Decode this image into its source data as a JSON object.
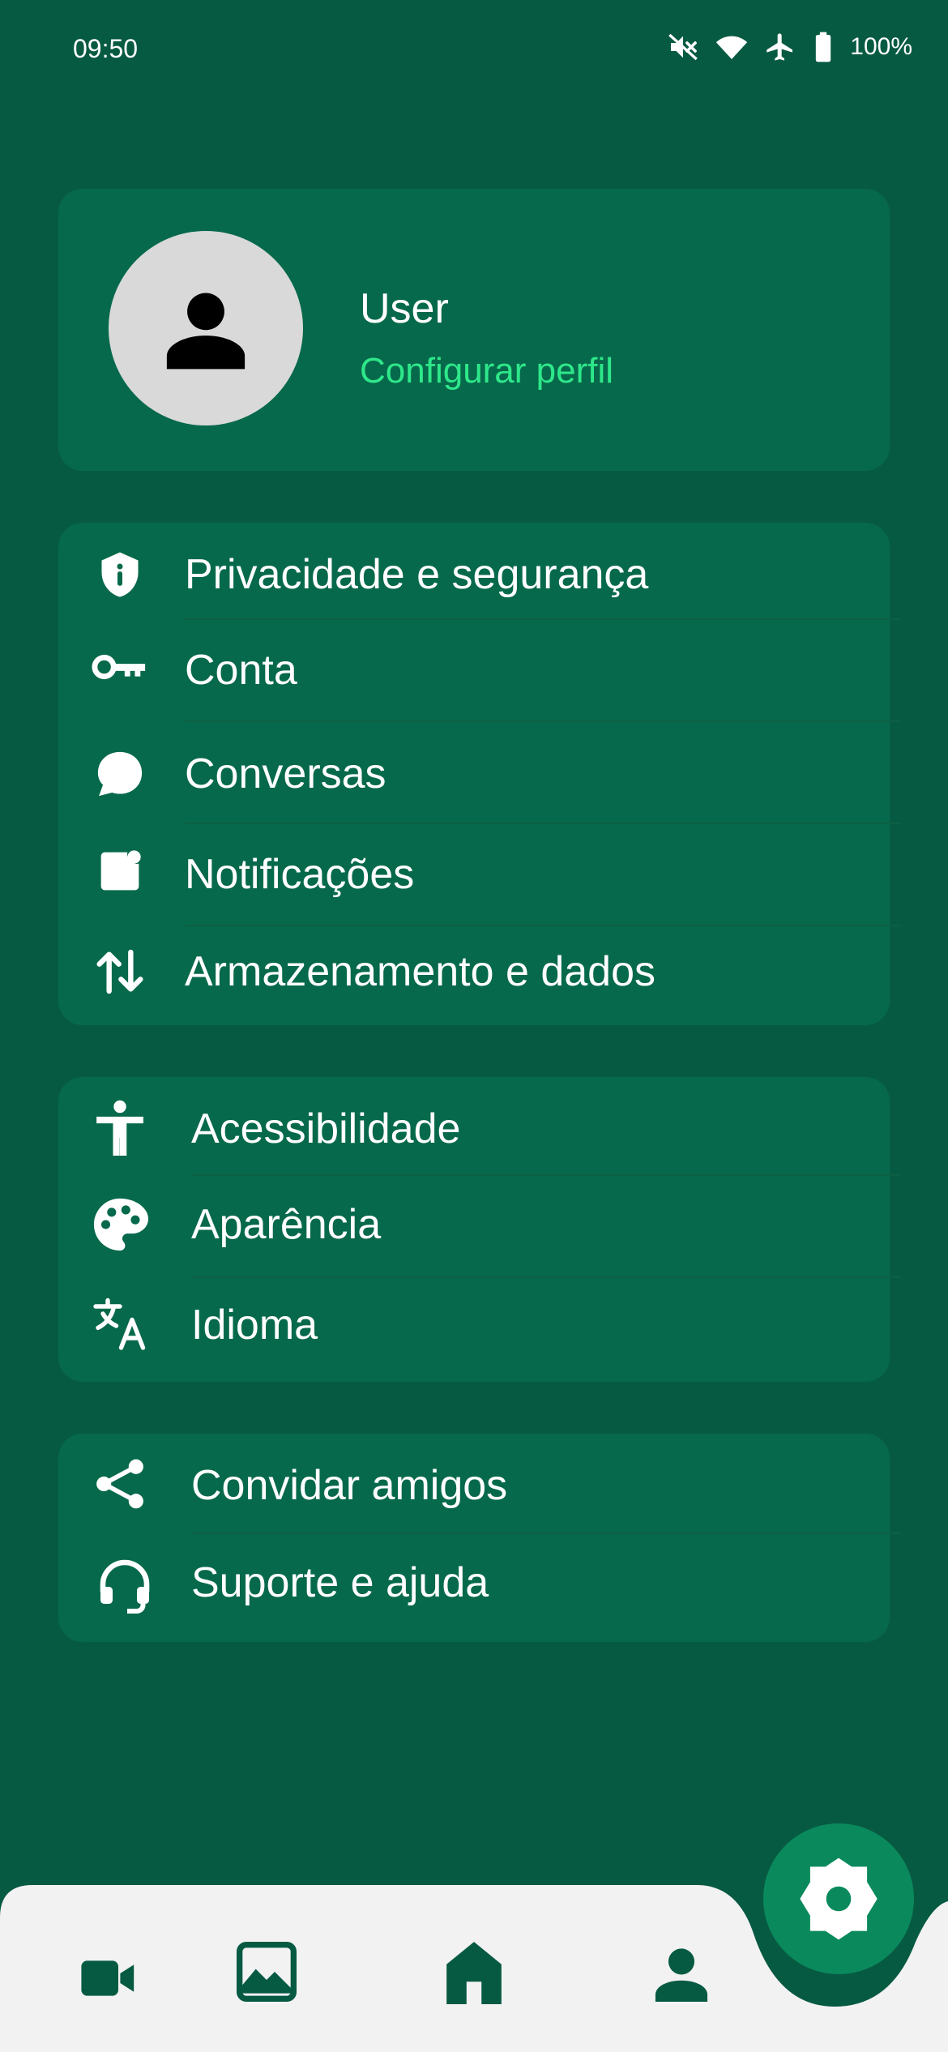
{
  "status_bar": {
    "time": "09:50",
    "battery_text": "100%",
    "icons": [
      "mute-icon",
      "wifi-icon",
      "airplane-icon",
      "battery-icon"
    ]
  },
  "profile": {
    "name": "User",
    "link": "Configurar perfil"
  },
  "settings": {
    "group1": [
      {
        "label": "Privacidade e segurança",
        "icon": "shield-icon"
      },
      {
        "label": "Conta",
        "icon": "key-icon"
      },
      {
        "label": "Conversas",
        "icon": "chat-bubble-icon"
      },
      {
        "label": "Notificações",
        "icon": "notification-icon"
      },
      {
        "label": "Armazenamento e dados",
        "icon": "data-transfer-icon"
      }
    ],
    "group2": [
      {
        "label": "Acessibilidade",
        "icon": "accessibility-icon"
      },
      {
        "label": "Aparência",
        "icon": "palette-icon"
      },
      {
        "label": "Idioma",
        "icon": "translate-icon"
      }
    ],
    "group3": [
      {
        "label": "Convidar amigos",
        "icon": "share-icon"
      },
      {
        "label": "Suporte e ajuda",
        "icon": "headset-icon"
      }
    ]
  },
  "bottom_nav": {
    "items": [
      "video-camera-icon",
      "gallery-icon",
      "home-icon",
      "profile-icon"
    ],
    "fab_icon": "settings-gear-icon"
  },
  "colors": {
    "background": "#075a42",
    "card": "#07694b",
    "accent": "#2ee78a",
    "nav_background": "#f2f2f2",
    "nav_icon": "#075a42",
    "fab": "#0a8a5c"
  }
}
